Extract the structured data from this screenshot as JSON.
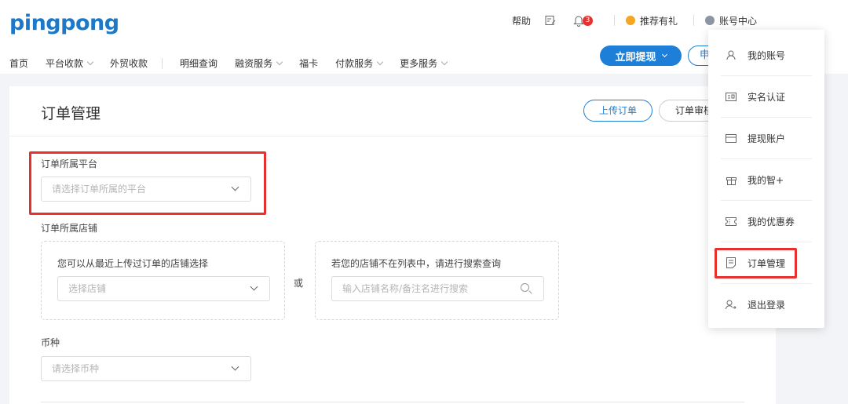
{
  "logo": "pingpong",
  "top_right": {
    "help": "帮助",
    "badge_count": "3",
    "recommend": "推荐有礼",
    "account_center": "账号中心"
  },
  "nav": [
    {
      "label": "首页",
      "dropdown": false
    },
    {
      "label": "平台收款",
      "dropdown": true
    },
    {
      "label": "外贸收款",
      "dropdown": false
    },
    {
      "label": "明细查询",
      "dropdown": false
    },
    {
      "label": "融资服务",
      "dropdown": true
    },
    {
      "label": "福卡",
      "dropdown": false
    },
    {
      "label": "付款服务",
      "dropdown": true
    },
    {
      "label": "更多服务",
      "dropdown": true
    }
  ],
  "actions": {
    "withdraw": "立即提现",
    "apply_partial": "申"
  },
  "page": {
    "title": "订单管理",
    "upload_btn": "上传订单",
    "audit_btn": "订单审核"
  },
  "form": {
    "platform_label": "订单所属平台",
    "platform_placeholder": "请选择订单所属的平台",
    "store_label": "订单所属店铺",
    "recent_store_hint": "您可以从最近上传过订单的店铺选择",
    "store_select_placeholder": "选择店铺",
    "or_text": "或",
    "search_hint": "若您的店铺不在列表中，请进行搜索查询",
    "search_placeholder": "输入店铺名称/备注名进行搜索",
    "currency_label": "币种",
    "currency_placeholder": "请选择币种"
  },
  "dropdown_menu": [
    {
      "label": "我的账号",
      "icon": "user-icon"
    },
    {
      "label": "实名认证",
      "icon": "id-card-icon"
    },
    {
      "label": "提现账户",
      "icon": "bank-card-icon"
    },
    {
      "label": "我的智+",
      "icon": "gift-icon"
    },
    {
      "label": "我的优惠券",
      "icon": "coupon-icon"
    },
    {
      "label": "订单管理",
      "icon": "order-doc-icon"
    },
    {
      "label": "退出登录",
      "icon": "logout-icon"
    }
  ],
  "colors": {
    "brand_blue": "#1d7fd8",
    "highlight_red": "#e8312f",
    "badge_red": "#e8312f",
    "recommend_yellow": "#f5a623"
  }
}
